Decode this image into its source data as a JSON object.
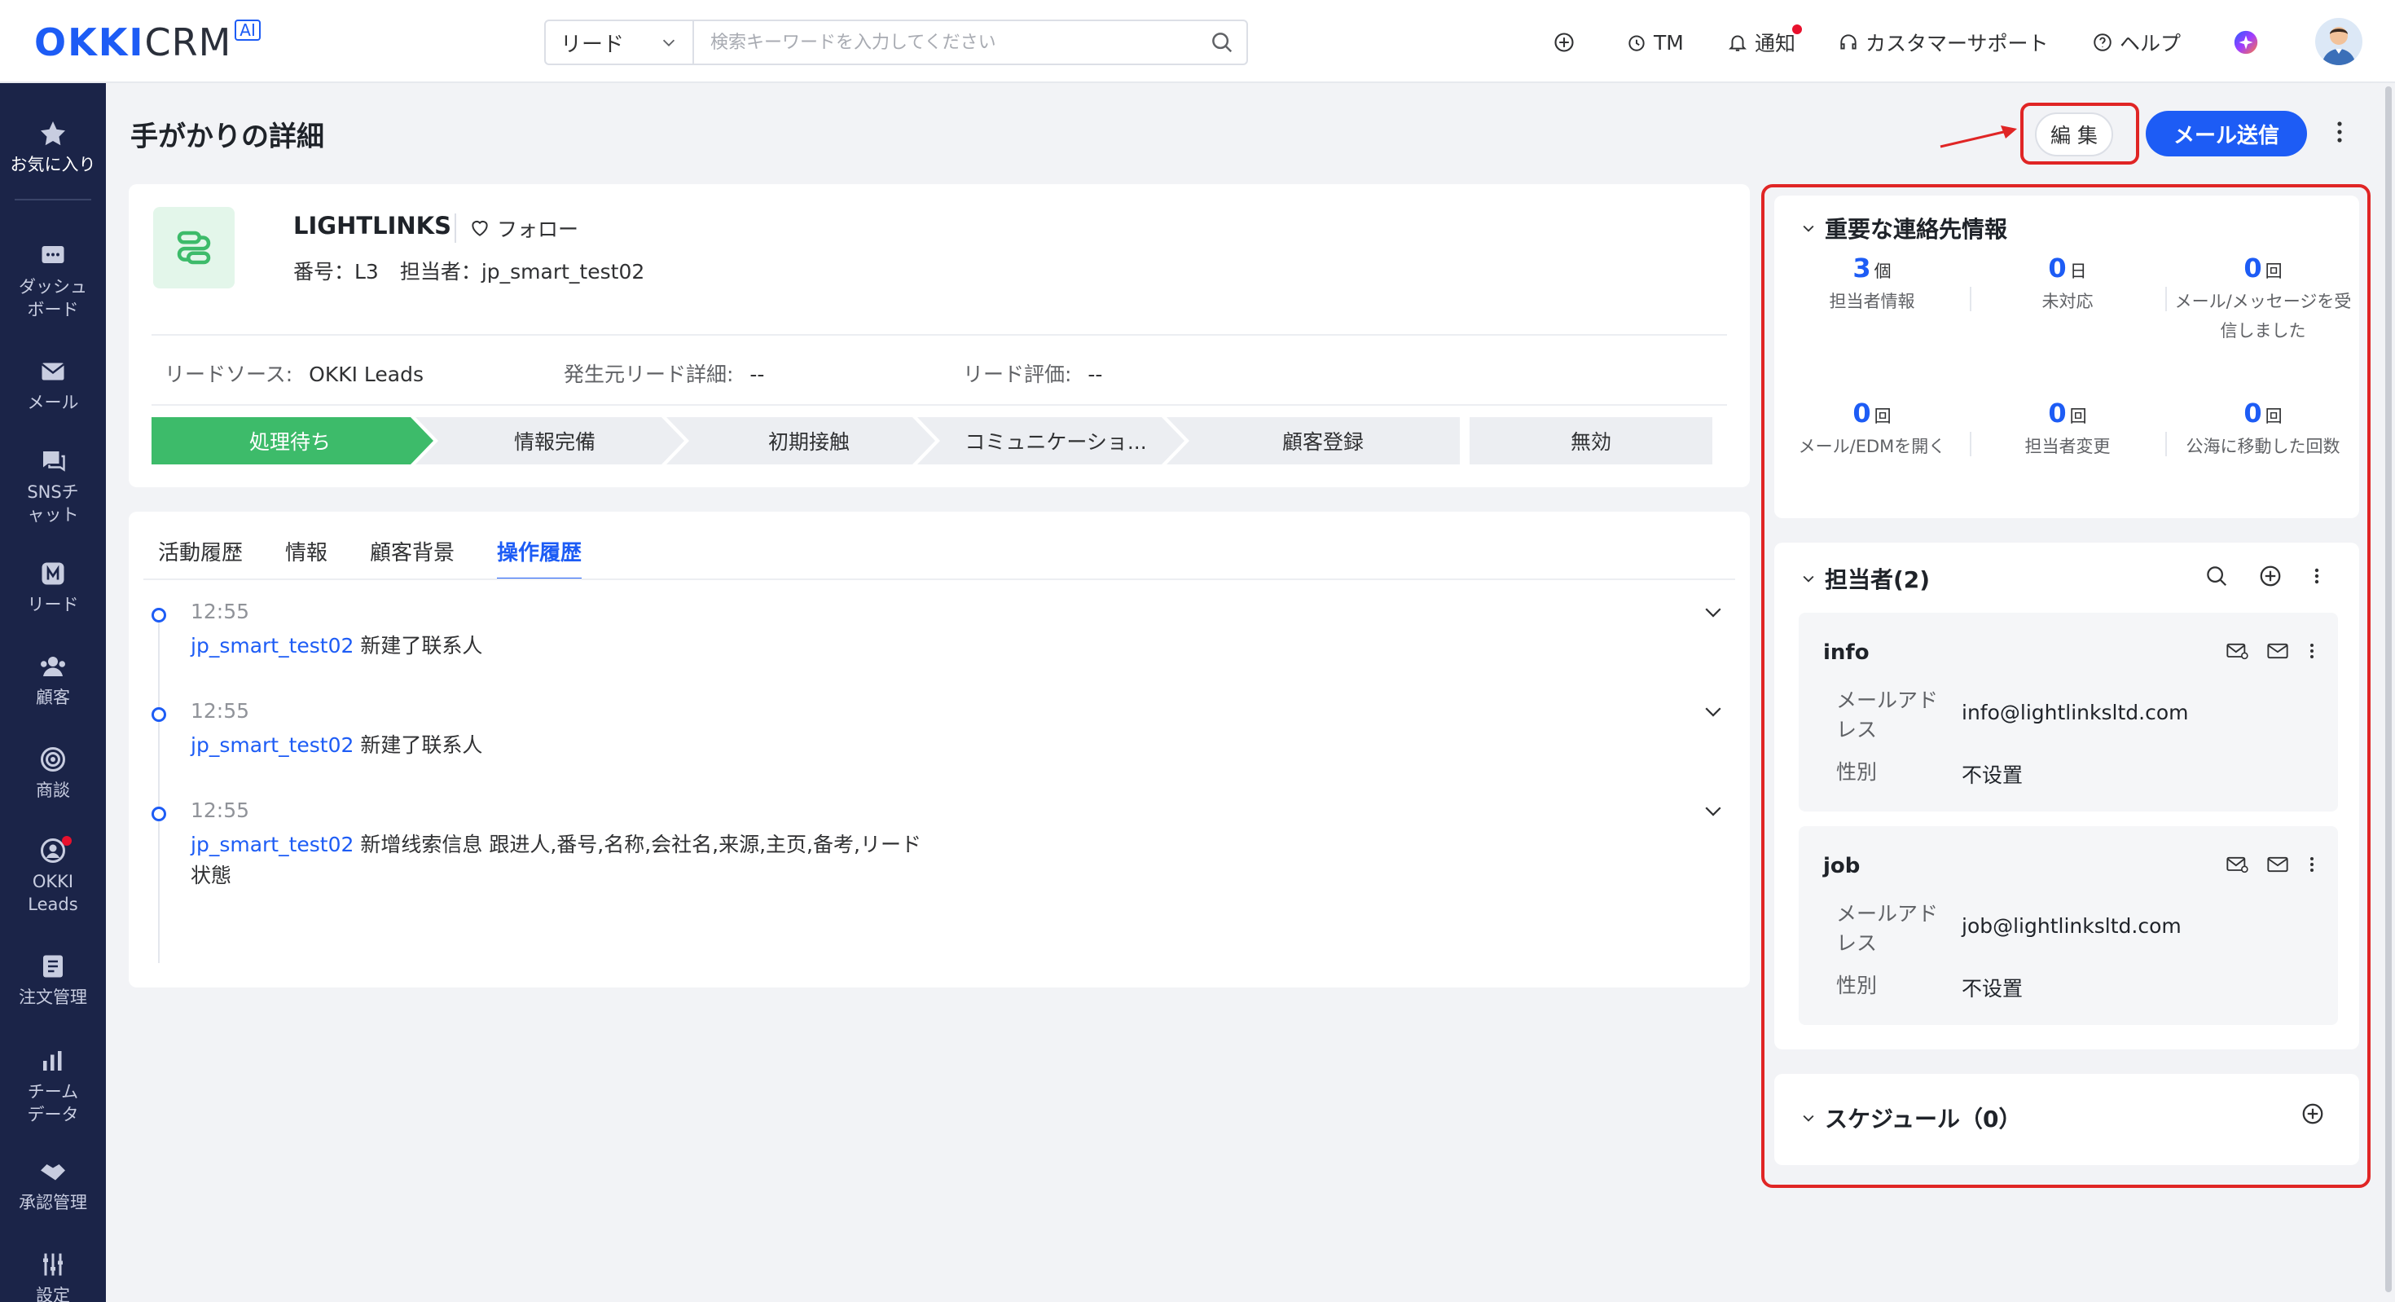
{
  "brand": {
    "okki": "OKKI",
    "crm": "CRM",
    "ai": "AI"
  },
  "search": {
    "scope": "リード",
    "placeholder": "検索キーワードを入力してください"
  },
  "topnav": {
    "tm": "TM",
    "notify": "通知",
    "support": "カスタマーサポート",
    "help": "ヘルプ"
  },
  "sidebar": {
    "items": [
      {
        "label": "お気に入り",
        "icon": "star-icon"
      },
      {
        "label": "ダッシュボード",
        "icon": "dashboard-icon"
      },
      {
        "label": "メール",
        "icon": "mail-icon"
      },
      {
        "label": "SNSチャット",
        "icon": "chat-icon"
      },
      {
        "label": "リード",
        "icon": "lead-icon"
      },
      {
        "label": "顧客",
        "icon": "customer-icon"
      },
      {
        "label": "商談",
        "icon": "target-icon"
      },
      {
        "label": "OKKI Leads",
        "icon": "okki-leads-icon"
      },
      {
        "label": "注文管理",
        "icon": "order-icon"
      },
      {
        "label": "チームデータ",
        "icon": "bar-chart-icon"
      },
      {
        "label": "承認管理",
        "icon": "handshake-icon"
      },
      {
        "label": "設定",
        "icon": "settings-icon"
      }
    ]
  },
  "page": {
    "title": "手がかりの詳細",
    "edit_label": "編 集",
    "send_mail_label": "メール送信"
  },
  "lead": {
    "name": "LIGHTLINKS",
    "follow_label": "フォロー",
    "number": "番号：L3",
    "owner": "担当者：jp_smart_test02",
    "source_label": "リードソース:",
    "source_value": "OKKI Leads",
    "origin_label": "発生元リード詳細:",
    "origin_value": "--",
    "rating_label": "リード評価:",
    "rating_value": "--",
    "stages": [
      "処理待ち",
      "情報完備",
      "初期接触",
      "コミュニケーショ...",
      "顧客登録",
      "無効"
    ],
    "active_stage": "処理待ち"
  },
  "activity": {
    "tabs": [
      "活動履歴",
      "情報",
      "顧客背景",
      "操作履歴"
    ],
    "active_tab": "操作履歴",
    "entries": [
      {
        "time": "12:55",
        "user": "jp_smart_test02",
        "text": "新建了联系人"
      },
      {
        "time": "12:55",
        "user": "jp_smart_test02",
        "text": "新建了联系人"
      },
      {
        "time": "12:55",
        "user": "jp_smart_test02",
        "text": "新增线索信息 跟进人,番号,名称,会社名,来源,主页,备考,リード状態"
      }
    ]
  },
  "key_contact": {
    "title": "重要な連絡先情報",
    "stats": [
      {
        "num": "3",
        "unit": "個",
        "label": "担当者情報"
      },
      {
        "num": "0",
        "unit": "日",
        "label": "未対応"
      },
      {
        "num": "0",
        "unit": "回",
        "label": "メール/メッセージを受信しました"
      },
      {
        "num": "0",
        "unit": "回",
        "label": "メール/EDMを開く"
      },
      {
        "num": "0",
        "unit": "回",
        "label": "担当者変更"
      },
      {
        "num": "0",
        "unit": "回",
        "label": "公海に移動した回数"
      }
    ]
  },
  "contacts": {
    "title": "担当者(2)",
    "items": [
      {
        "name": "info",
        "email_label": "メールアドレス",
        "email": "info@lightlinksltd.com",
        "gender_label": "性別",
        "gender": "不设置"
      },
      {
        "name": "job",
        "email_label": "メールアドレス",
        "email": "job@lightlinksltd.com",
        "gender_label": "性別",
        "gender": "不设置"
      }
    ]
  },
  "schedule": {
    "title": "スケジュール（0）"
  },
  "colors": {
    "accent": "#1d5cf5",
    "active_stage": "#3dbb6a",
    "highlight": "#e02525",
    "sidebar": "#1b2448"
  }
}
